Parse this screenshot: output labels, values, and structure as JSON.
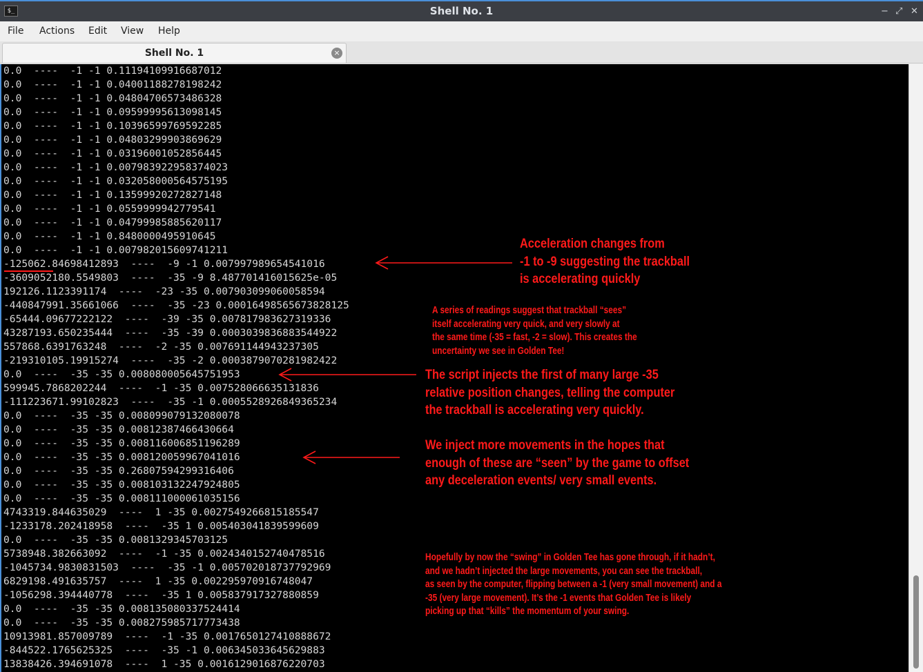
{
  "window": {
    "title": "Shell No. 1",
    "app_icon_glyph": "$_",
    "minimize": "−",
    "restore": "⤢",
    "close": "✕"
  },
  "menu": [
    "File",
    "Actions",
    "Edit",
    "View",
    "Help"
  ],
  "tab": {
    "label": "Shell No. 1",
    "close_glyph": "×"
  },
  "terminal": {
    "lines": [
      "0.0  ----  -1 -1 0.11194109916687012",
      "0.0  ----  -1 -1 0.04001188278198242",
      "0.0  ----  -1 -1 0.04804706573486328",
      "0.0  ----  -1 -1 0.09599995613098145",
      "0.0  ----  -1 -1 0.10396599769592285",
      "0.0  ----  -1 -1 0.04803299903869629",
      "0.0  ----  -1 -1 0.03196001052856445",
      "0.0  ----  -1 -1 0.007983922958374023",
      "0.0  ----  -1 -1 0.032058000564575195",
      "0.0  ----  -1 -1 0.13599920272827148",
      "0.0  ----  -1 -1 0.0559999942779541",
      "0.0  ----  -1 -1 0.04799985885620117",
      "0.0  ----  -1 -1 0.8480000495910645",
      "0.0  ----  -1 -1 0.007982015609741211",
      "-125062.84698412893  ----  -9 -1 0.007997989654541016",
      "-3609052180.5549803  ----  -35 -9 8.487701416015625e-05",
      "192126.1123391174  ----  -23 -35 0.007903099060058594",
      "-440847991.35661066  ----  -35 -23 0.00016498565673828125",
      "-65444.09677222122  ----  -39 -35 0.007817983627319336",
      "43287193.650235444  ----  -35 -39 0.0003039836883544922",
      "557868.6391763248  ----  -2 -35 0.007691144943237305",
      "-219310105.19915274  ----  -35 -2 0.0003879070281982422",
      "0.0  ----  -35 -35 0.008080005645751953",
      "599945.7868202244  ----  -1 -35 0.007528066635131836",
      "-111223671.99102823  ----  -35 -1 0.0005528926849365234",
      "0.0  ----  -35 -35 0.008099079132080078",
      "0.0  ----  -35 -35 0.00812387466430664",
      "0.0  ----  -35 -35 0.008116006851196289",
      "0.0  ----  -35 -35 0.008120059967041016",
      "0.0  ----  -35 -35 0.26807594299316406",
      "0.0  ----  -35 -35 0.008103132247924805",
      "0.0  ----  -35 -35 0.008111000061035156",
      "4743319.844635029  ----  1 -35 0.0027549266815185547",
      "-1233178.202418958  ----  -35 1 0.005403041839599609",
      "0.0  ----  -35 -35 0.0081329345703125",
      "5738948.382663092  ----  -1 -35 0.0024340152740478516",
      "-1045734.9830831503  ----  -35 -1 0.005702018737792969",
      "6829198.491635757  ----  1 -35 0.002295970916748047",
      "-1056298.394440778  ----  -35 1 0.005837917327880859",
      "0.0  ----  -35 -35 0.008135080337524414",
      "0.0  ----  -35 -35 0.008275985717773438",
      "10913981.857009789  ----  -1 -35 0.0017650127410888672",
      "-844522.1765625325  ----  -35 -1 0.006345033645629883",
      "13838426.394691078  ----  1 -35 0.0016129016876220703"
    ]
  },
  "annotations": {
    "accel": "Acceleration changes from\n-1 to -9 suggesting the trackball\nis accelerating quickly",
    "series": "A series of readings suggest that trackball “sees”\nitself accelerating very quick, and very slowly at\nthe same time (-35 = fast, -2 = slow). This creates the\nuncertainty we see in Golden Tee!",
    "inject": "The script injects the first of many large -35\nrelative position changes, telling the computer\nthe trackball is accelerating very quickly.",
    "more": "We inject more movements in the hopes that\nenough of these are “seen” by the game to offset\nany deceleration events/ very small events.",
    "swing": "Hopefully by now the “swing” in Golden Tee has gone through, if it hadn’t,\nand we hadn’t injected the large movements, you can see the trackball,\nas seen by the computer, flipping between a -1 (very small movement) and a\n-35 (very large movement). It’s the -1 events that Golden Tee is likely\npicking up that “kills” the momentum of your swing."
  },
  "colors": {
    "annotation": "#ff1a1a",
    "terminal_bg": "#000000",
    "terminal_fg": "#d6d6d6",
    "accent": "#4a90d9"
  }
}
